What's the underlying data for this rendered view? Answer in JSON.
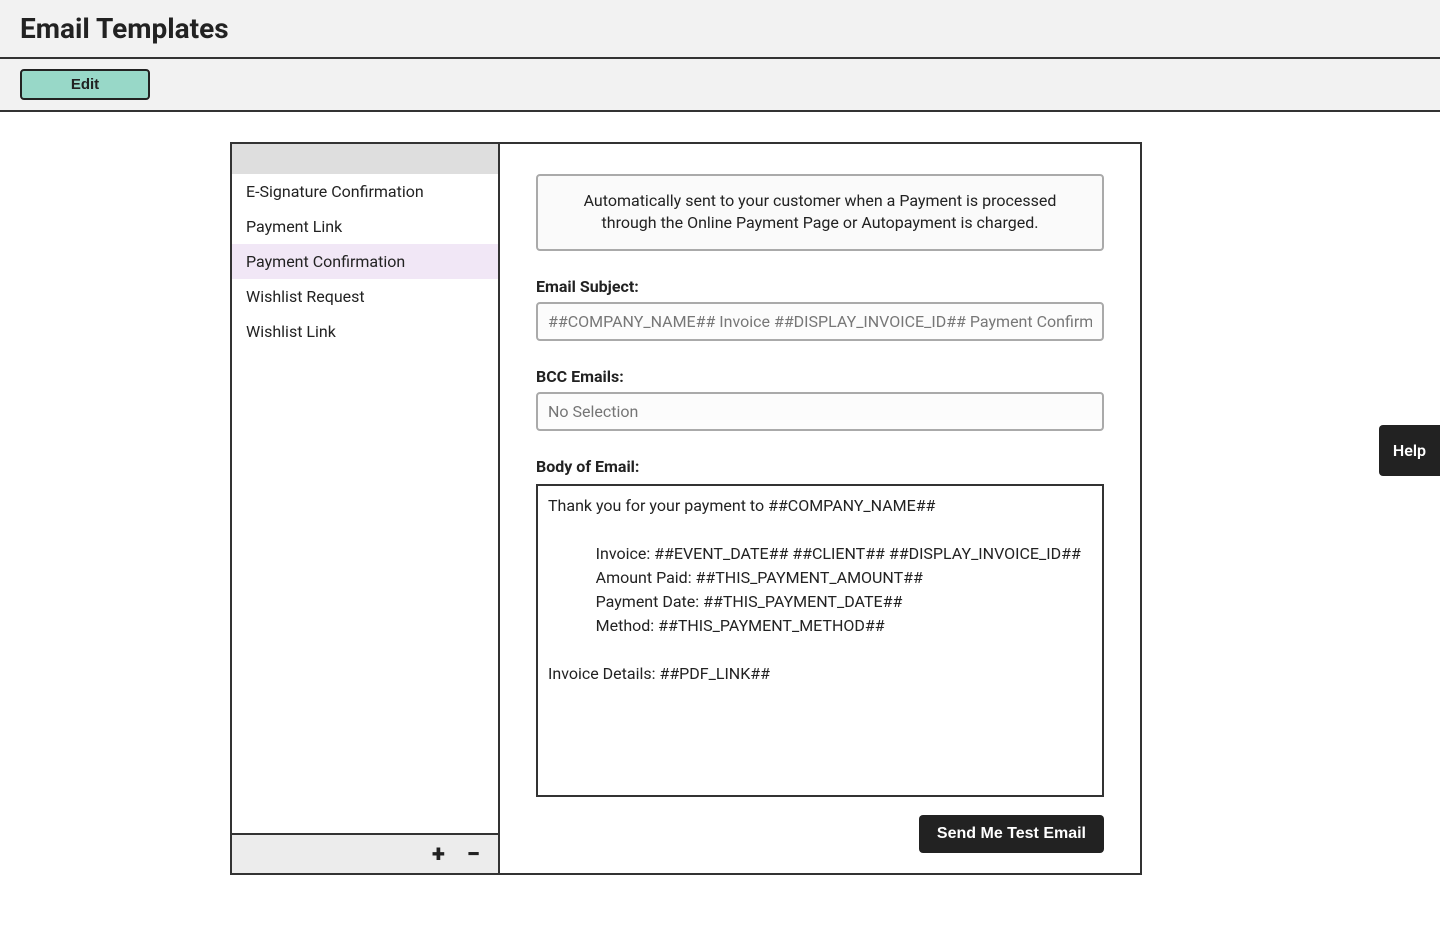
{
  "header": {
    "title": "Email Templates",
    "edit_label": "Edit"
  },
  "sidebar": {
    "items": [
      {
        "label": "E-Signature Confirmation",
        "active": false
      },
      {
        "label": "Payment Link",
        "active": false
      },
      {
        "label": "Payment Confirmation",
        "active": true
      },
      {
        "label": "Wishlist Request",
        "active": false
      },
      {
        "label": "Wishlist Link",
        "active": false
      }
    ],
    "footer": {
      "add_icon_label": "+",
      "remove_icon_label": "−"
    }
  },
  "main": {
    "description": "Automatically sent to your customer when a Payment is processed through the Online Payment Page or Autopayment is charged.",
    "subject_label": "Email Subject:",
    "subject_value": "##COMPANY_NAME## Invoice ##DISPLAY_INVOICE_ID## Payment Confirmati",
    "bcc_label": "BCC  Emails:",
    "bcc_placeholder": "No Selection",
    "body_label": "Body of Email:",
    "body_value": "Thank you for your payment to ##COMPANY_NAME##\n\n            Invoice: ##EVENT_DATE## ##CLIENT## ##DISPLAY_INVOICE_ID##\n            Amount Paid: ##THIS_PAYMENT_AMOUNT##\n            Payment Date: ##THIS_PAYMENT_DATE##\n            Method: ##THIS_PAYMENT_METHOD##\n\nInvoice Details: ##PDF_LINK##",
    "test_button_label": "Send Me Test Email"
  },
  "help": {
    "label": "Help"
  }
}
